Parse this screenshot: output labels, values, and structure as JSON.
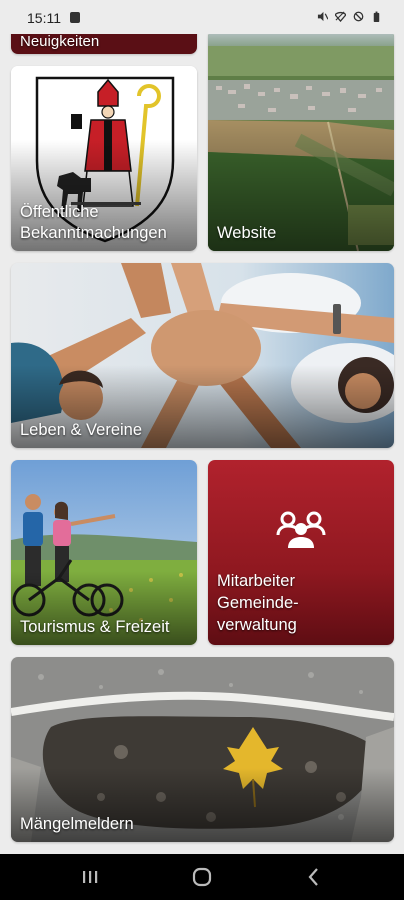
{
  "status": {
    "time": "15:11",
    "icons": [
      "notification-icon",
      "mute-icon",
      "wifi-icon",
      "dnd-icon",
      "battery-icon"
    ]
  },
  "tiles": [
    {
      "id": "news",
      "label": "Neuigkeiten",
      "icon": "news-image"
    },
    {
      "id": "bekanntmachungen",
      "label": "Öffentliche Bekanntmachungen",
      "icon": "coat-of-arms-image"
    },
    {
      "id": "website",
      "label": "Website",
      "icon": "aerial-town-image"
    },
    {
      "id": "leben",
      "label": "Leben & Vereine",
      "icon": "hands-together-image"
    },
    {
      "id": "tourismus",
      "label": "Tourismus & Freizeit",
      "icon": "cyclists-image"
    },
    {
      "id": "mitarbeiter",
      "label": "Mitarbeiter Gemeinde-verwaltung",
      "icon": "people-group-icon"
    },
    {
      "id": "maengel",
      "label": "Mängelmeldern",
      "icon": "pothole-leaf-image"
    }
  ],
  "colors": {
    "brand": "#a31d27",
    "brand_dark": "#5a0f15",
    "background": "#ececec"
  },
  "navigation": [
    "recent-apps-icon",
    "home-icon",
    "back-icon"
  ]
}
